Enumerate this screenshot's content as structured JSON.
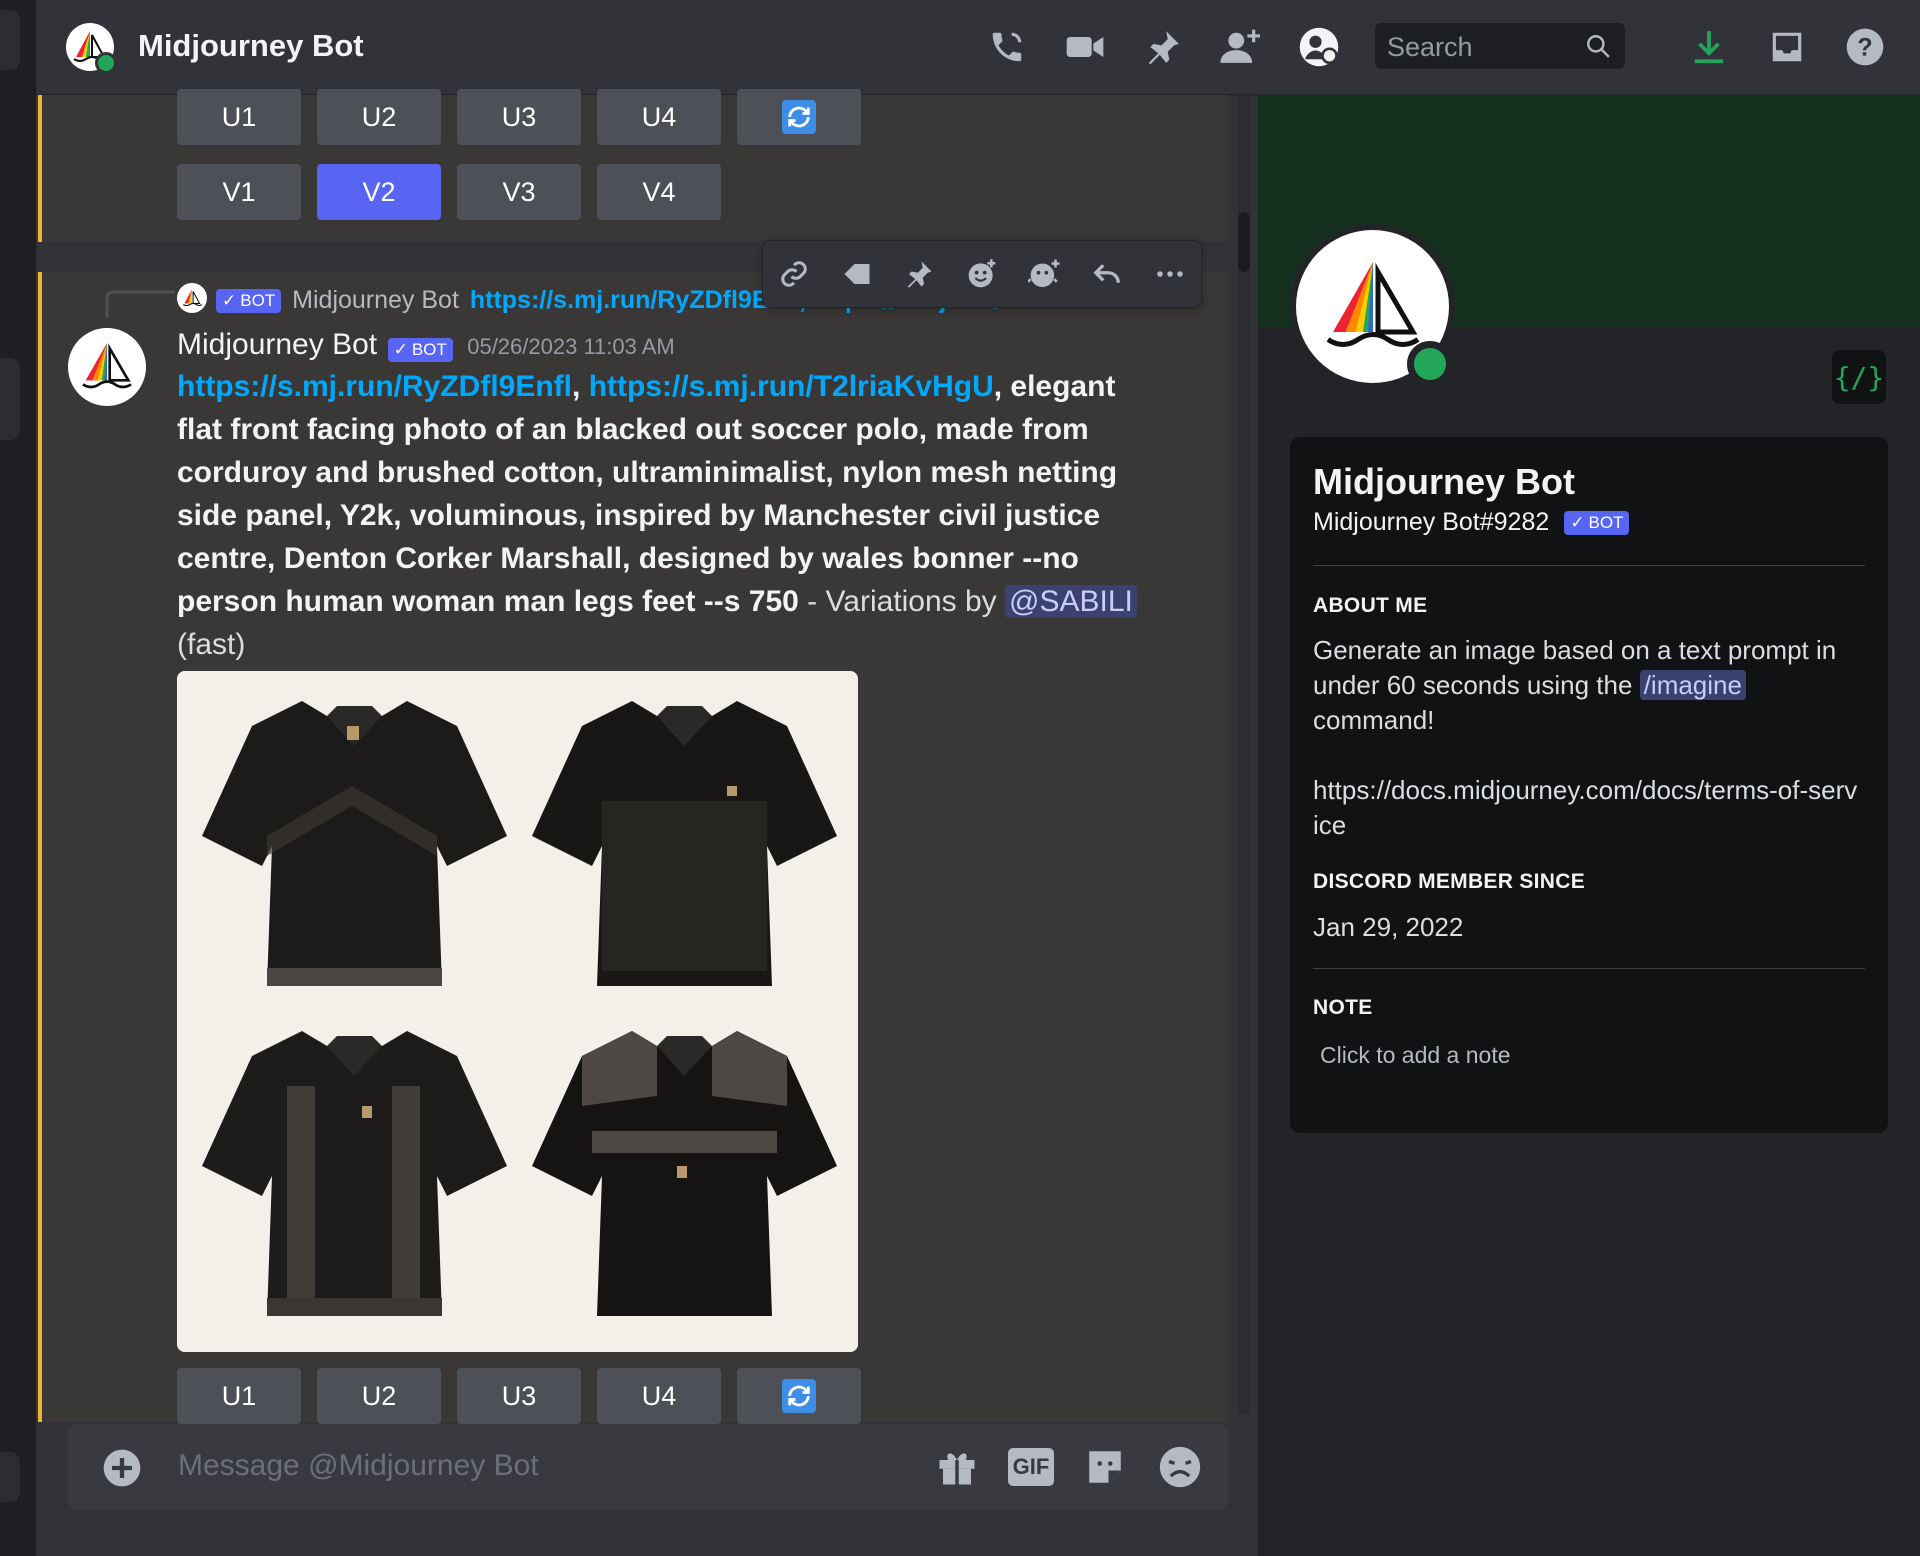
{
  "header": {
    "title": "Midjourney Bot",
    "search_placeholder": "Search",
    "icons": [
      "phone-call-icon",
      "video-icon",
      "pin-icon",
      "add-friend-icon",
      "profile-toggle-icon",
      "download-icon",
      "inbox-icon",
      "help-icon"
    ]
  },
  "prev_message": {
    "upscale_buttons": [
      "U1",
      "U2",
      "U3",
      "U4"
    ],
    "variation_buttons": [
      "V1",
      "V2",
      "V3",
      "V4"
    ],
    "active_variation": "V2"
  },
  "reply_preview": {
    "author": "Midjourney Bot",
    "badge": "BOT",
    "text": "https://s.mj.run/RyZDfl9Enfl, https://s.mj.run/T2"
  },
  "toolbar_icons": [
    "link-icon",
    "mark-unread-icon",
    "pin-icon",
    "add-reaction-icon",
    "add-super-reaction-icon",
    "reply-icon",
    "more-icon"
  ],
  "message": {
    "author": "Midjourney Bot",
    "badge": "BOT",
    "timestamp": "05/26/2023 11:03 AM",
    "link1": "https://s.mj.run/RyZDfl9Enfl",
    "sep1": ", ",
    "link2": "https://s.mj.run/T2lriaKvHgU",
    "prompt": ", elegant flat front facing photo of an blacked out soccer polo, made from corduroy and brushed cotton, ultraminimalist, nylon mesh netting side panel, Y2k, voluminous, inspired by Manchester civil justice centre, Denton Corker Marshall, designed by wales bonner --no person human woman man legs feet --s 750",
    "variations_text": " - Variations by ",
    "mention": "@SABILI",
    "speed": "(fast)",
    "upscale_buttons": [
      "U1",
      "U2",
      "U3",
      "U4"
    ]
  },
  "composer": {
    "placeholder": "Message @Midjourney Bot",
    "gif_label": "GIF"
  },
  "profile": {
    "name": "Midjourney Bot",
    "tag": "Midjourney Bot#9282",
    "badge": "BOT",
    "dev_badge": "{/}",
    "about_heading": "ABOUT ME",
    "about_text_1": "Generate an image based on a text prompt in under 60 seconds using the ",
    "about_command": "/imagine",
    "about_text_2": " command!",
    "about_link": "https://docs.midjourney.com/docs/terms-of-service",
    "member_heading": "DISCORD MEMBER SINCE",
    "member_since": "Jan 29, 2022",
    "note_heading": "NOTE",
    "note_placeholder": "Click to add a note"
  },
  "colors": {
    "accent": "#5865f2",
    "link": "#00a8fc",
    "online": "#23a55a",
    "highlight_bar": "#f0b232"
  }
}
